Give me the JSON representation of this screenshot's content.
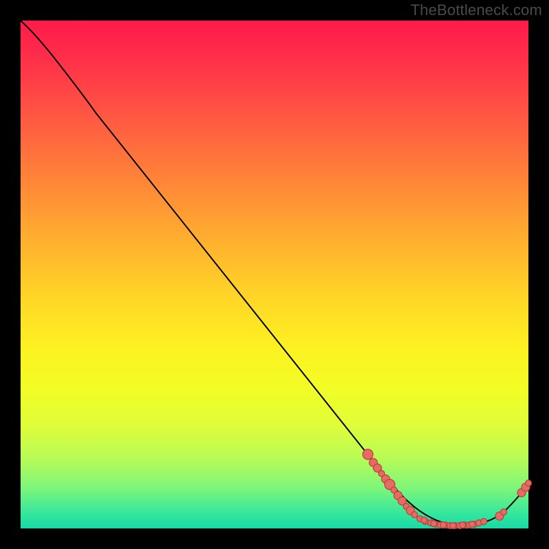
{
  "watermark": "TheBottleneck.com",
  "chart_data": {
    "type": "line",
    "title": "",
    "xlabel": "",
    "ylabel": "",
    "x": [
      0.0,
      0.04,
      0.08,
      0.12,
      0.18,
      0.28,
      0.38,
      0.48,
      0.58,
      0.68,
      0.74,
      0.78,
      0.82,
      0.86,
      0.9,
      0.94,
      0.97,
      1.0
    ],
    "y": [
      1.0,
      0.965,
      0.925,
      0.88,
      0.8,
      0.66,
      0.52,
      0.38,
      0.245,
      0.12,
      0.06,
      0.03,
      0.012,
      0.005,
      0.005,
      0.02,
      0.048,
      0.085
    ],
    "xlim": [
      0,
      1
    ],
    "ylim": [
      0,
      1
    ],
    "scatter_clusters": {
      "descending_segment": {
        "x_range": [
          0.68,
          0.78
        ],
        "y_range": [
          0.03,
          0.13
        ],
        "count": 12
      },
      "valley_floor": {
        "x_range": [
          0.8,
          0.92
        ],
        "y_range": [
          0.005,
          0.012
        ],
        "count": 20
      },
      "ascending_segment": {
        "x_range": [
          0.94,
          1.0
        ],
        "y_range": [
          0.02,
          0.09
        ],
        "count": 5
      }
    }
  }
}
